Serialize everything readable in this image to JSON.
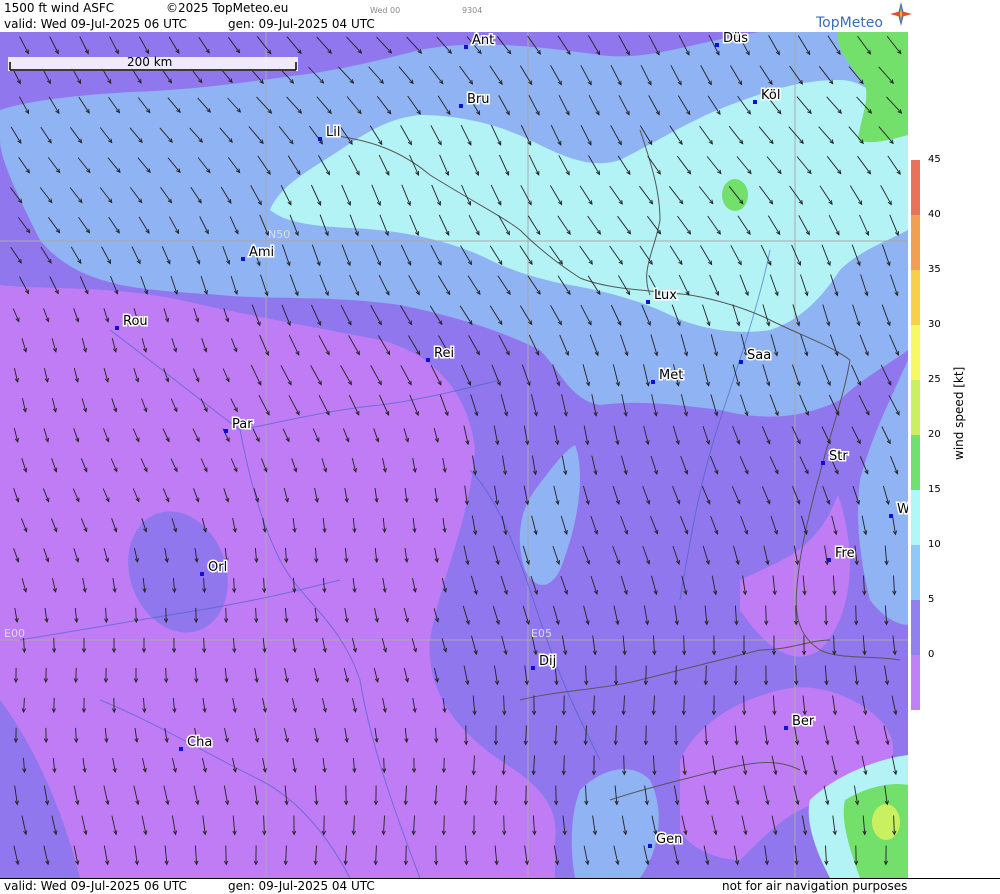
{
  "header": {
    "product": "1500 ft wind ASFC",
    "copyright": "©2025 TopMeteo.eu",
    "day_small": "Wed 00",
    "code_small": "9304",
    "valid": "valid:  Wed  09-Jul-2025  06 UTC",
    "gen": "gen: 09-Jul-2025 04 UTC",
    "logo": "TopMeteo"
  },
  "footer": {
    "valid": "valid:  Wed  09-Jul-2025  06 UTC",
    "gen": "gen: 09-Jul-2025 04 UTC",
    "disclaimer": "not for air navigation purposes"
  },
  "scale_bar": {
    "label": "200 km"
  },
  "grid_labels": {
    "n50": "N50",
    "e00": "E00",
    "e05": "E05"
  },
  "cities": [
    {
      "name": "Ant"
    },
    {
      "name": "Düs"
    },
    {
      "name": "Bru"
    },
    {
      "name": "Köl"
    },
    {
      "name": "Lil"
    },
    {
      "name": "Ami"
    },
    {
      "name": "Lux"
    },
    {
      "name": "Rou"
    },
    {
      "name": "Rei"
    },
    {
      "name": "Saa"
    },
    {
      "name": "Met"
    },
    {
      "name": "Par"
    },
    {
      "name": "Str"
    },
    {
      "name": "W"
    },
    {
      "name": "Fre"
    },
    {
      "name": "Orl"
    },
    {
      "name": "Dij"
    },
    {
      "name": "Ber"
    },
    {
      "name": "Cha"
    },
    {
      "name": "Gen"
    }
  ],
  "legend": {
    "title": "wind speed [kt]",
    "ticks": [
      "45",
      "40",
      "35",
      "30",
      "25",
      "20",
      "15",
      "10",
      "5",
      "0"
    ],
    "colors": [
      "#e8735a",
      "#f0a050",
      "#f7d048",
      "#f8f860",
      "#c8f060",
      "#70e070",
      "#b0f8f8",
      "#90c8f8",
      "#9080f0",
      "#c080f8"
    ]
  },
  "palette": {
    "purple_light": "#c07cf5",
    "purple": "#9177ee",
    "blue": "#8fb3f3",
    "cyan": "#b3f3f6",
    "green": "#72e06a",
    "lime": "#c8f060"
  }
}
